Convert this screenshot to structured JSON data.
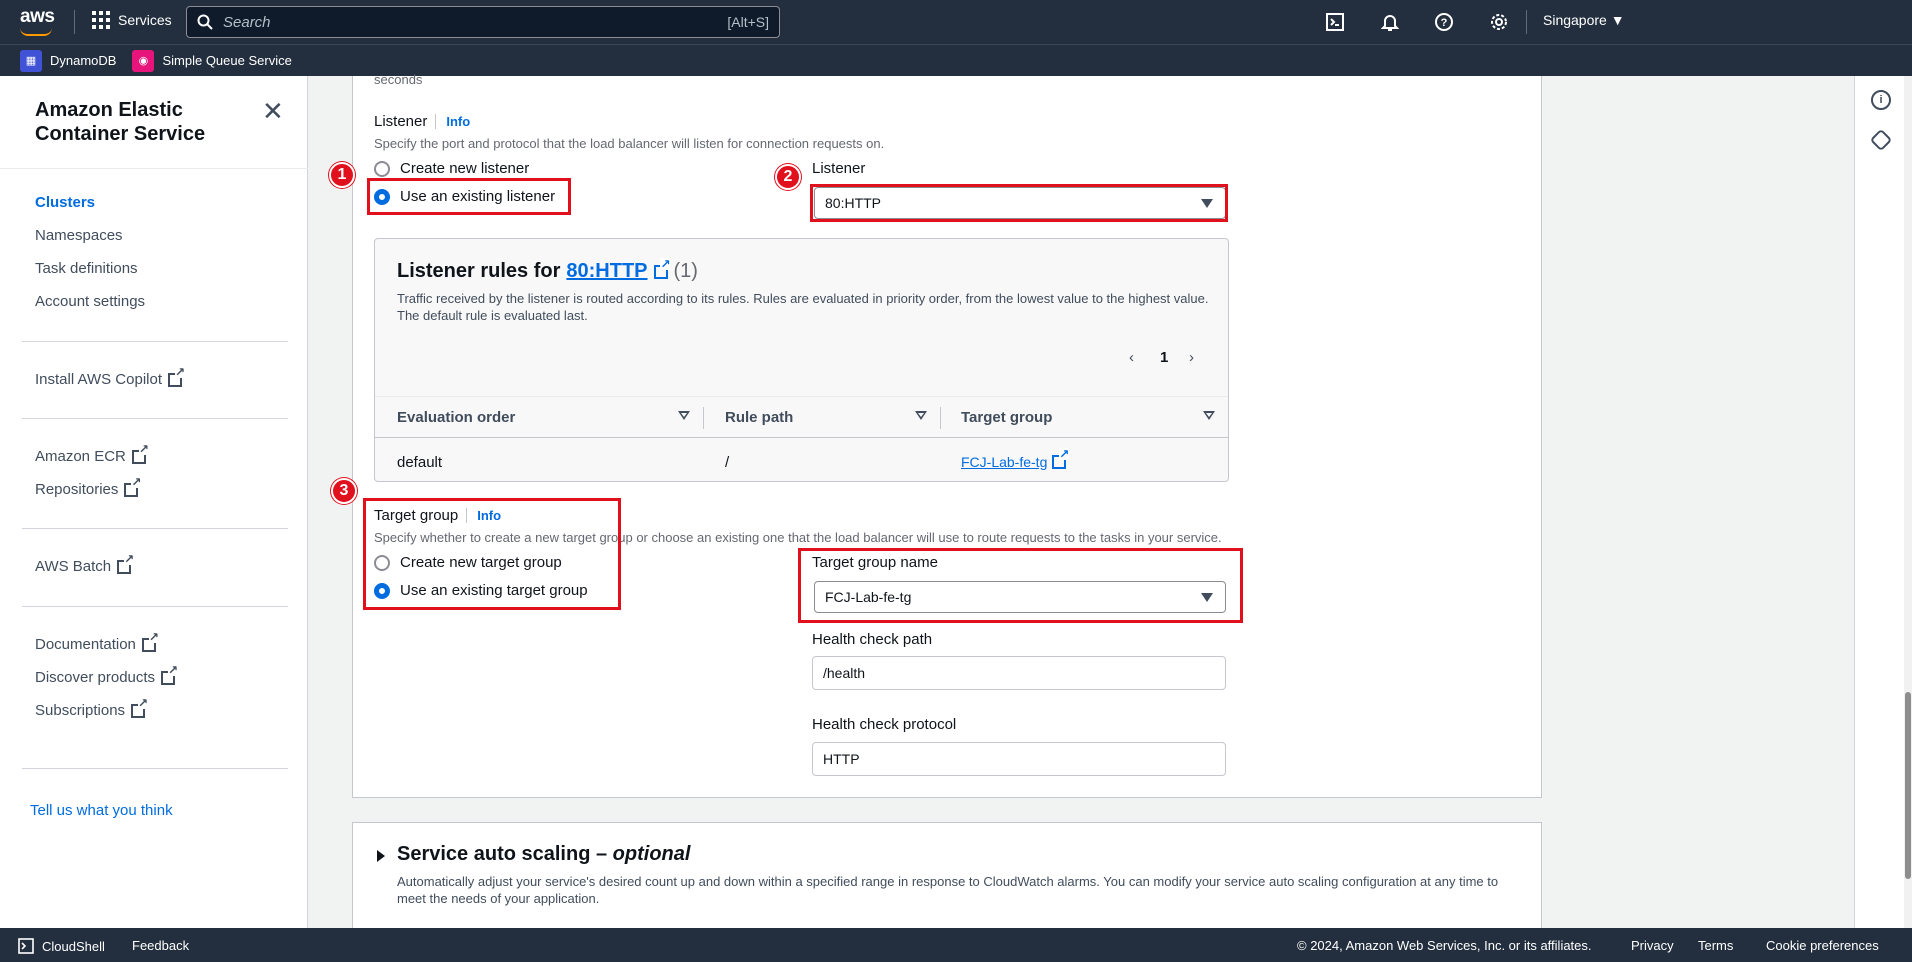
{
  "topnav": {
    "logo": "aws",
    "services_label": "Services",
    "search_placeholder": "Search",
    "search_shortcut": "[Alt+S]",
    "region": "Singapore ▼",
    "icons": [
      "cloudshell-icon",
      "bell-icon",
      "help-icon",
      "settings-icon"
    ]
  },
  "favorites": [
    {
      "label": "DynamoDB",
      "icon": "dynamodb-icon",
      "color": "#4053d6"
    },
    {
      "label": "Simple Queue Service",
      "icon": "sqs-icon",
      "color": "#e7157b"
    }
  ],
  "sidenav": {
    "title": "Amazon Elastic Container Service",
    "primary": [
      "Clusters",
      "Namespaces",
      "Task definitions",
      "Account settings"
    ],
    "copilot": "Install AWS Copilot",
    "ecr": [
      "Amazon ECR",
      "Repositories"
    ],
    "batch": "AWS Batch",
    "resources": [
      "Documentation",
      "Discover products",
      "Subscriptions"
    ],
    "feedback": "Tell us what you think"
  },
  "form": {
    "top_fragment": "seconds",
    "listener_label": "Listener",
    "info": "Info",
    "listener_desc": "Specify the port and protocol that the load balancer will listen for connection requests on.",
    "listener_opt_new": "Create new listener",
    "listener_opt_existing": "Use an existing listener",
    "listener_select_label": "Listener",
    "listener_select_value": "80:HTTP",
    "rules": {
      "title_prefix": "Listener rules for",
      "title_link": "80:HTTP",
      "count": "(1)",
      "desc": "Traffic received by the listener is routed according to its rules. Rules are evaluated in priority order, from the lowest value to the highest value. The default rule is evaluated last.",
      "page": "1",
      "columns": [
        "Evaluation order",
        "Rule path",
        "Target group"
      ],
      "row": {
        "order": "default",
        "path": "/",
        "target": "FCJ-Lab-fe-tg"
      }
    },
    "tg_label": "Target group",
    "tg_desc": "Specify whether to create a new target group or choose an existing one that the load balancer will use to route requests to the tasks in your service.",
    "tg_opt_new": "Create new target group",
    "tg_opt_existing": "Use an existing target group",
    "tg_name_label": "Target group name",
    "tg_name_value": "FCJ-Lab-fe-tg",
    "hc_path_label": "Health check path",
    "hc_path_value": "/health",
    "hc_protocol_label": "Health check protocol",
    "hc_protocol_value": "HTTP"
  },
  "annotations": [
    "1",
    "2",
    "3"
  ],
  "autoscaling": {
    "title": "Service auto scaling –",
    "title_em": "optional",
    "desc": "Automatically adjust your service's desired count up and down within a specified range in response to CloudWatch alarms. You can modify your service auto scaling configuration at any time to meet the needs of your application."
  },
  "footer": {
    "cloudshell": "CloudShell",
    "feedback": "Feedback",
    "copyright": "© 2024, Amazon Web Services, Inc. or its affiliates.",
    "privacy": "Privacy",
    "terms": "Terms",
    "cookies": "Cookie preferences"
  }
}
